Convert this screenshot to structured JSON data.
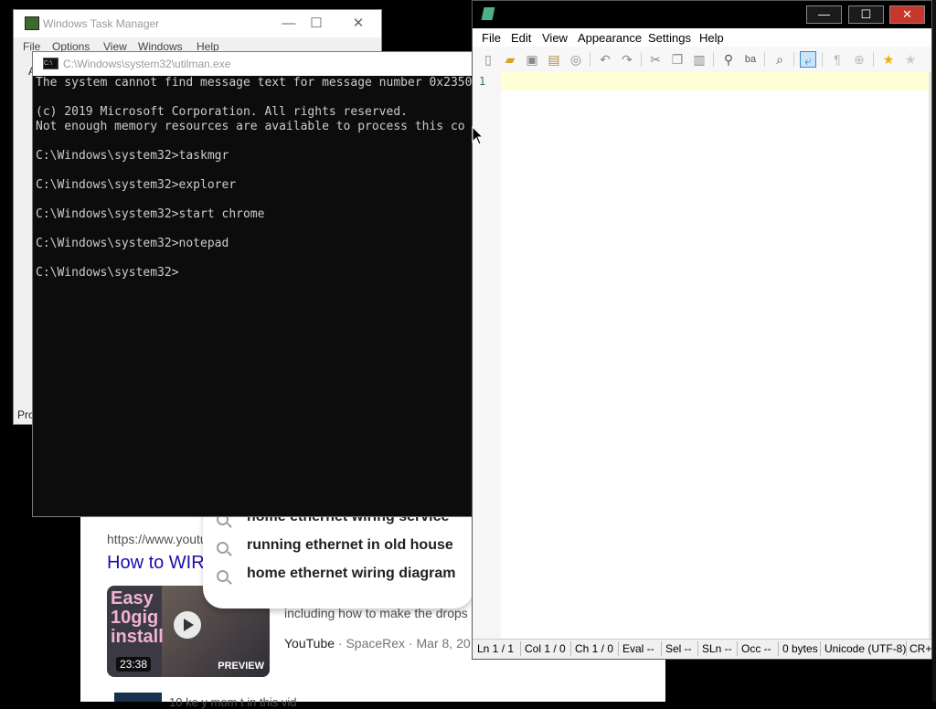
{
  "taskmgr": {
    "title": "Windows Task Manager",
    "menu": [
      "File",
      "Options",
      "View",
      "Windows",
      "Help"
    ],
    "partial_label": "A",
    "status_partial": "Pro",
    "minimize": "—",
    "maximize": "☐",
    "close": "✕"
  },
  "browser": {
    "url": "https://www.youtu",
    "result_title": "How to WIR",
    "thumb_text": "Easy 10gig install",
    "duration": "23:38",
    "preview": "PREVIEW",
    "snippet": "including how to make the drops",
    "source": "YouTube",
    "channel": "SpaceRex",
    "date": "Mar 8, 20",
    "next_text": "10 ke  y mom  t  in this vid"
  },
  "suggestions": [
    "home ethernet wiring service",
    "running ethernet in old house",
    "home ethernet wiring diagram"
  ],
  "cmd": {
    "title": "C:\\Windows\\system32\\utilman.exe",
    "icon_text": "C:\\",
    "lines": [
      "The system cannot find message text for message number 0x2350",
      "",
      "(c) 2019 Microsoft Corporation. All rights reserved.",
      "Not enough memory resources are available to process this co",
      "",
      "C:\\Windows\\system32>taskmgr",
      "",
      "C:\\Windows\\system32>explorer",
      "",
      "C:\\Windows\\system32>start chrome",
      "",
      "C:\\Windows\\system32>notepad",
      "",
      "C:\\Windows\\system32>"
    ]
  },
  "notepad": {
    "menu": [
      "File",
      "Edit",
      "View",
      "Appearance",
      "Settings",
      "Help"
    ],
    "minimize": "—",
    "maximize": "☐",
    "close": "✕",
    "line_number": "1",
    "toolbar_icons": [
      "new-file-icon",
      "open-folder-icon",
      "save-icon",
      "save-as-icon",
      "revert-icon",
      "undo-icon",
      "redo-icon",
      "cut-icon",
      "copy-icon",
      "paste-icon",
      "find-icon",
      "replace-icon",
      "zoom-icon",
      "word-wrap-icon",
      "whitespace-icon",
      "zoom-in-icon",
      "favorite-icon",
      "add-favorite-icon"
    ],
    "status": {
      "ln": "Ln  1 / 1",
      "col": "Col  1 / 0",
      "ch": "Ch  1 / 0",
      "eval": "Eval  --",
      "sel": "Sel  --",
      "sln": "SLn  --",
      "occ": "Occ  --",
      "size": "0 bytes",
      "encoding": "Unicode (UTF-8)",
      "eol": "CR+"
    }
  }
}
